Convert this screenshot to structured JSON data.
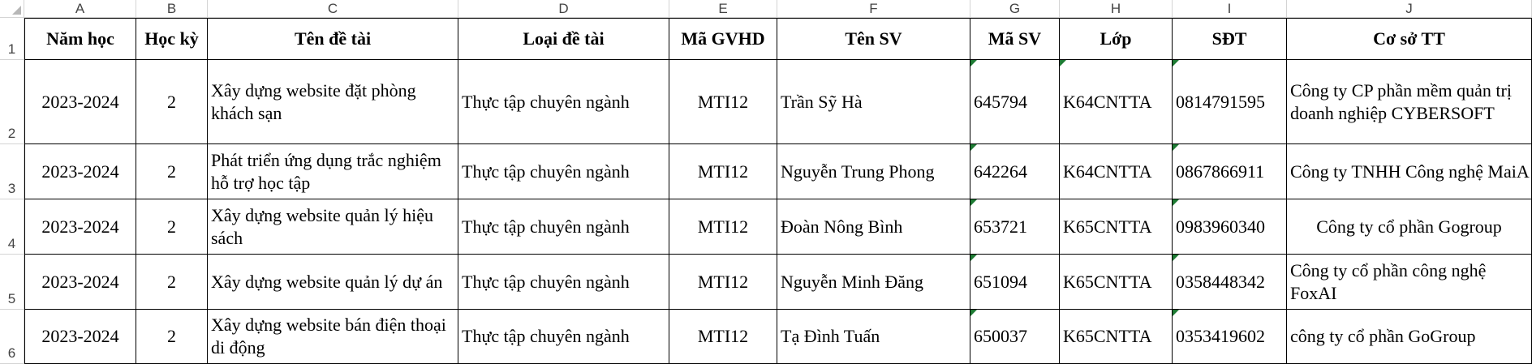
{
  "columns": [
    "A",
    "B",
    "C",
    "D",
    "E",
    "F",
    "G",
    "H",
    "I",
    "J"
  ],
  "row_numbers": [
    "1",
    "2",
    "3",
    "4",
    "5",
    "6"
  ],
  "headers": [
    "Năm học",
    "Học kỳ",
    "Tên đề tài",
    "Loại đề tài",
    "Mã GVHD",
    "Tên SV",
    "Mã SV",
    "Lớp",
    "SĐT",
    "Cơ sở TT"
  ],
  "rows": [
    [
      "2023-2024",
      "2",
      "Xây dựng website đặt phòng khách sạn",
      "Thực tập chuyên ngành",
      "MTI12",
      "Trần Sỹ Hà",
      "645794",
      "K64CNTTA",
      "0814791595",
      "Công ty CP phần mềm quản trị doanh nghiệp CYBERSOFT"
    ],
    [
      "2023-2024",
      "2",
      "Phát triển ứng dụng trắc nghiệm hỗ trợ học tập",
      "Thực tập chuyên ngành",
      "MTI12",
      "Nguyễn Trung Phong",
      "642264",
      "K64CNTTA",
      "0867866911",
      "Công ty TNHH Công nghệ MaiA"
    ],
    [
      "2023-2024",
      "2",
      "Xây dựng website quản lý hiệu sách",
      "Thực tập chuyên ngành",
      "MTI12",
      "Đoàn Nông Bình",
      "653721",
      "K65CNTTA",
      "0983960340",
      "Công ty cổ phần Gogroup"
    ],
    [
      "2023-2024",
      "2",
      "Xây dựng website quản lý dự án",
      "Thực tập chuyên ngành",
      "MTI12",
      "Nguyễn Minh Đăng",
      "651094",
      "K65CNTTA",
      "0358448342",
      "Công ty cổ phần công nghệ FoxAI"
    ],
    [
      "2023-2024",
      "2",
      "Xây dựng website bán điện thoại di động",
      "Thực tập chuyên ngành",
      "MTI12",
      "Tạ Đình Tuấn",
      "650037",
      "K65CNTTA",
      "0353419602",
      "công ty cổ phần GoGroup"
    ]
  ],
  "colors": {
    "grid_border": "#000000",
    "header_line": "#d4d4d4",
    "error_flag": "#1e7b34"
  }
}
